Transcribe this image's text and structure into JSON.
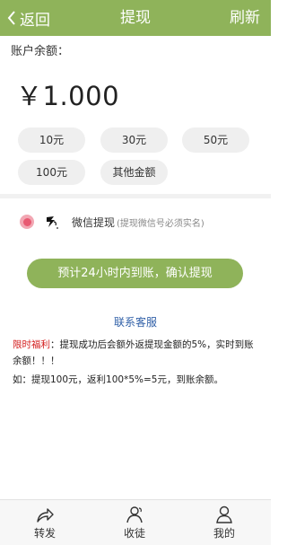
{
  "header": {
    "back_label": "返回",
    "title": "提现",
    "refresh_label": "刷新",
    "bg_color": "#8fb35a"
  },
  "balance": {
    "label": "账户余额：",
    "amount": "￥1.000"
  },
  "amount_options": [
    "10元",
    "30元",
    "50元",
    "100元",
    "其他金额"
  ],
  "payment": {
    "method": "微信提现",
    "note": "(提现微信号必须实名)",
    "selected": true
  },
  "confirm_button": "预计24小时内到账，确认提现",
  "contact_label": "联系客服",
  "welfare": {
    "tag": "限时福利",
    "text": "：提现成功后会额外返提现金额的5%，实时到账余额！！！"
  },
  "example_text": "如：提现100元，返利100*5%=5元，到账余额。",
  "bottom_nav": [
    {
      "label": "转发",
      "icon": "share-icon"
    },
    {
      "label": "收徒",
      "icon": "users-icon"
    },
    {
      "label": "我的",
      "icon": "user-icon"
    }
  ]
}
